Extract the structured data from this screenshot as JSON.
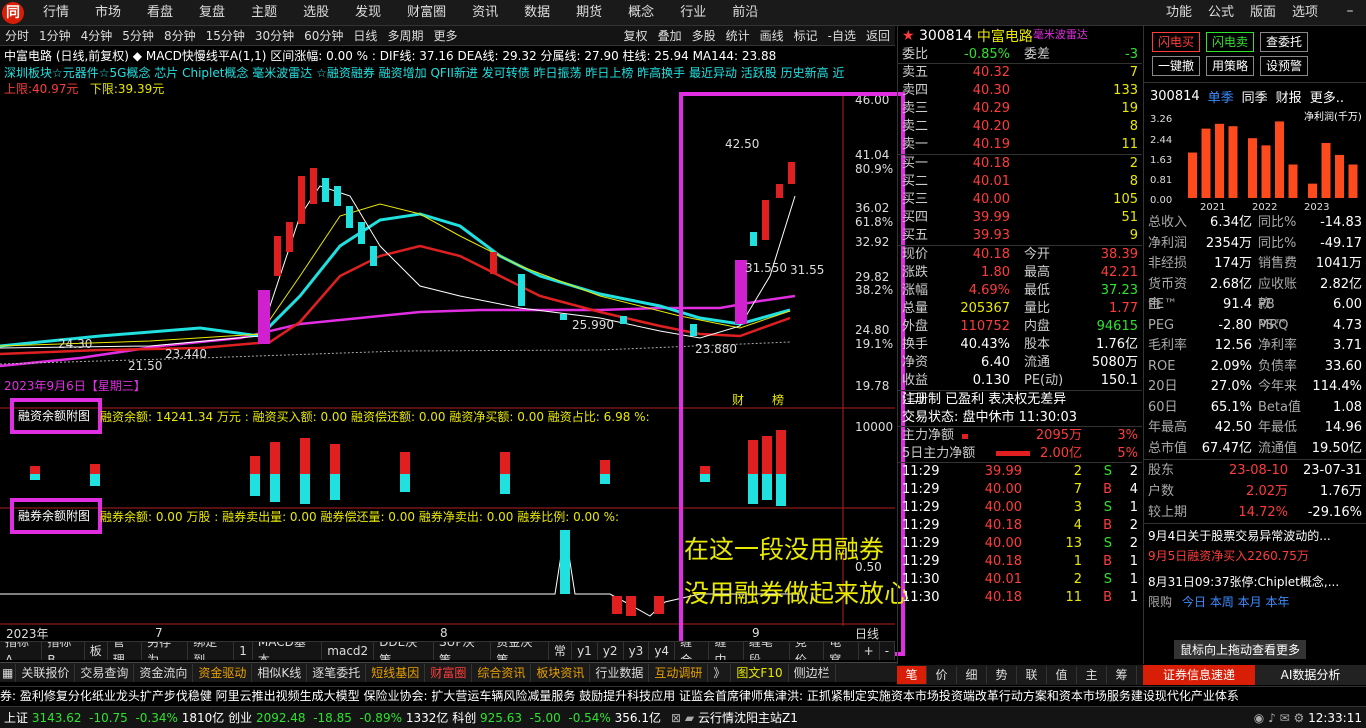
{
  "topmenu": {
    "logo": "同",
    "items": [
      "行情",
      "市场",
      "看盘",
      "复盘",
      "主题",
      "选股",
      "发现",
      "财富圈",
      "资讯",
      "数据",
      "期货",
      "概念",
      "行业",
      "前沿"
    ],
    "right": [
      "功能",
      "公式",
      "版面",
      "选项"
    ]
  },
  "toolbar": {
    "periods": [
      "分时",
      "1分钟",
      "4分钟",
      "5分钟",
      "8分钟",
      "15分钟",
      "30分钟",
      "60分钟",
      "日线",
      "多周期",
      "更多"
    ],
    "tools": [
      "复权",
      "叠加",
      "多股",
      "统计",
      "画线",
      "标记",
      "-自选",
      "返回"
    ]
  },
  "info": {
    "line1": "中富电路 (日线,前复权) ◆ MACD快慢线平A(1,1)  区间涨幅: 0.00 % : DIF线: 37.16  DEA线: 29.32  分属线: 27.90  柱线: 25.94  MA144: 23.88",
    "line2": "深圳板块☆元器件☆5G概念 芯片 Chiplet概念 毫米波雷达 ☆融资融券 融资增加 QFII新进 发可转债 昨日振荡 昨日上榜 昨高换手 最近异动 活跃股 历史新高 近",
    "upper": "上限:40.97元",
    "lower": "下限:39.39元"
  },
  "price_axis": [
    "46.00",
    "41.04",
    "80.9%",
    "36.02",
    "61.8%",
    "32.92",
    "29.82",
    "38.2%",
    "24.80",
    "19.1%",
    "19.78"
  ],
  "chart_labels": {
    "high": "42.50",
    "mid": "31.550",
    "mid2": "31.55",
    "low1": "25.990",
    "low2": "23.880",
    "l1": "24.30",
    "l2": "23.440",
    "l3": "21.50",
    "date": "2023年9月6日【星期三】",
    "cai": "财",
    "bang": "榜"
  },
  "sub1": {
    "title": "融资余额附图",
    "text": "融资余额: 14241.34 万元 :  融资买入额: 0.00  融资偿还额: 0.00  融资净买额: 0.00  融资占比: 6.98 %:",
    "axis": "10000"
  },
  "sub2": {
    "title": "融券余额附图",
    "text": "融券余额: 0.00 万股 :  融券卖出量: 0.00  融券偿还量: 0.00  融券净卖出: 0.00  融券比例: 0.00 %:",
    "axis": "0.50"
  },
  "annotation": {
    "line1": "在这一段没用融券",
    "line2": "没用融券做起来放心"
  },
  "xaxis": {
    "l1": "2023年",
    "l2": "7",
    "l3": "8",
    "l4": "9",
    "day": "日线"
  },
  "bottomtabs": [
    "指标A",
    "指标B",
    "板",
    "管理",
    "另存为",
    "绑定到",
    "1",
    "MACD基本",
    "macd2",
    "DDE决策",
    "SUP决策",
    "资金决策",
    "常",
    "y1",
    "y2",
    "y3",
    "y4",
    "缠合",
    "缠中",
    "缠笔段",
    "竞价",
    "龟窝",
    "+",
    "-"
  ],
  "bottombar": [
    "关联报价",
    "交易查询",
    "资金流向",
    "资金驱动",
    "相似K线",
    "逐笔委托",
    "短线基因",
    "财富圈",
    "综合资讯",
    "板块资讯",
    "行业数据",
    "互动调研",
    "》",
    "图文F10",
    "侧边栏"
  ],
  "ticker": "券: 盈利修复分化纸业龙头扩产步伐稳健      阿里云推出视频生成大模型      保险业协会: 扩大营运车辆风险减量服务 鼓励提升科技应用      证监会首席律师焦津洪: 正抓紧制定实施资本市场投资端改革行动方案和资本市场服务建设现代化产业体系",
  "status": {
    "sh": "上证",
    "shv": "3143.62",
    "shc": "-10.75",
    "shp": "-0.34%",
    "shvol": "1810亿",
    "cy": "创业",
    "cyv": "2092.48",
    "cyc": "-18.85",
    "cyp": "-0.89%",
    "cyvol": "1332亿",
    "kc": "科创",
    "kcv": "925.63",
    "kcc": "-5.00",
    "kcp": "-0.54%",
    "kcvol": "356.1亿",
    "server": "云行情沈阳主站Z1",
    "time": "12:33:11"
  },
  "quote": {
    "code": "300814",
    "name": "中富电路",
    "tag": "毫米波雷达",
    "wb_label": "委比",
    "wb": "-0.85%",
    "wc_label": "委差",
    "wc": "-3",
    "asks": [
      {
        "l": "卖五",
        "p": "40.32",
        "v": "7"
      },
      {
        "l": "卖四",
        "p": "40.30",
        "v": "133"
      },
      {
        "l": "卖三",
        "p": "40.29",
        "v": "19"
      },
      {
        "l": "卖二",
        "p": "40.20",
        "v": "8"
      },
      {
        "l": "卖一",
        "p": "40.19",
        "v": "11"
      }
    ],
    "bids": [
      {
        "l": "买一",
        "p": "40.18",
        "v": "2"
      },
      {
        "l": "买二",
        "p": "40.01",
        "v": "8"
      },
      {
        "l": "买三",
        "p": "40.00",
        "v": "105"
      },
      {
        "l": "买四",
        "p": "39.99",
        "v": "51"
      },
      {
        "l": "买五",
        "p": "39.93",
        "v": "9"
      }
    ],
    "stats": [
      [
        "现价",
        "40.18",
        "今开",
        "38.39"
      ],
      [
        "涨跌",
        "1.80",
        "最高",
        "42.21"
      ],
      [
        "涨幅",
        "4.69%",
        "最低",
        "37.23"
      ],
      [
        "总量",
        "205367",
        "量比",
        "1.77"
      ],
      [
        "外盘",
        "110752",
        "内盘",
        "94615"
      ],
      [
        "换手",
        "40.43%",
        "股本",
        "1.76亿"
      ],
      [
        "净资",
        "6.40",
        "流通",
        "5080万"
      ],
      [
        "收益(二)",
        "0.130",
        "PE(动)",
        "150.1"
      ]
    ],
    "notes": "注册制 已盈利 表决权无差异",
    "state": "交易状态: 盘中休市 11:30:03",
    "flow1_l": "主力净额",
    "flow1_v": "2095万",
    "flow1_p": "3%",
    "flow2_l": "5日主力净额",
    "flow2_v": "2.00亿",
    "flow2_p": "5%",
    "ticks": [
      [
        "11:29",
        "39.99",
        "2",
        "S",
        "2"
      ],
      [
        "11:29",
        "40.00",
        "7",
        "B",
        "4"
      ],
      [
        "11:29",
        "40.00",
        "3",
        "S",
        "1"
      ],
      [
        "11:29",
        "40.18",
        "4",
        "B",
        "2"
      ],
      [
        "11:29",
        "40.00",
        "13",
        "S",
        "2"
      ],
      [
        "11:29",
        "40.18",
        "1",
        "B",
        "1"
      ],
      [
        "11:30",
        "40.01",
        "2",
        "S",
        "1"
      ],
      [
        "11:30",
        "40.18",
        "11",
        "B",
        "1"
      ]
    ],
    "tabs": [
      "笔",
      "价",
      "细",
      "势",
      "联",
      "值",
      "主",
      "筹"
    ]
  },
  "far": {
    "b1": "闪电买",
    "b2": "闪电卖",
    "b3": "查委托",
    "b4": "一键撤",
    "b5": "用策略",
    "b6": "设预警",
    "code": "300814",
    "t1": "单季",
    "t2": "同季",
    "t3": "财报",
    "t4": "更多..",
    "unit": "净利润(千万)",
    "years": [
      "2021",
      "2022",
      "2023"
    ],
    "yticks": [
      "3.26",
      "2.44",
      "1.63",
      "0.81",
      "0.00"
    ],
    "bars": [
      1.9,
      2.9,
      3.1,
      3.0,
      2.5,
      2.2,
      3.2,
      1.4,
      0.6,
      2.3,
      1.8,
      1.4
    ],
    "fin": [
      [
        "总收入",
        "6.34亿",
        "同比%",
        "-14.83"
      ],
      [
        "净利润",
        "2354万",
        "同比%",
        "-49.17"
      ],
      [
        "非经损",
        "174万",
        "销售费",
        "1041万"
      ],
      [
        "货币资金",
        "2.68亿",
        "应收账款",
        "2.82亿"
      ],
      [
        "PE™",
        "91.4",
        "PB MRQ",
        "6.00"
      ],
      [
        "PEG",
        "-2.80",
        "PS™",
        "4.73"
      ],
      [
        "毛利率",
        "12.56",
        "净利率",
        "3.71"
      ],
      [
        "ROE",
        "2.09%",
        "负债率",
        "33.60"
      ],
      [
        "20日",
        "27.0%",
        "今年来",
        "114.4%"
      ],
      [
        "60日",
        "65.1%",
        "Beta值",
        "1.08"
      ],
      [
        "年最高",
        "42.50",
        "年最低",
        "14.96"
      ],
      [
        "总市值",
        "67.47亿",
        "流通值",
        "19.50亿"
      ]
    ],
    "gd": [
      "股东",
      "23-08-10",
      "23-07-31"
    ],
    "hu": [
      "户数",
      "2.02万",
      "1.76万"
    ],
    "jsq": [
      "较上期",
      "14.72%",
      "-29.16%"
    ],
    "news1": "9月4日关于股票交易异常波动的...",
    "news2": "9月5日融资净买入2260.75万",
    "news3": "8月31日09:37张停:Chiplet概念,...",
    "hint": "鼠标向上拖动查看更多",
    "bottom1": "证券信息速递",
    "bottom2": "AI数据分析",
    "tail": "限购",
    "tail2": "今日 本周 本月 本年"
  }
}
